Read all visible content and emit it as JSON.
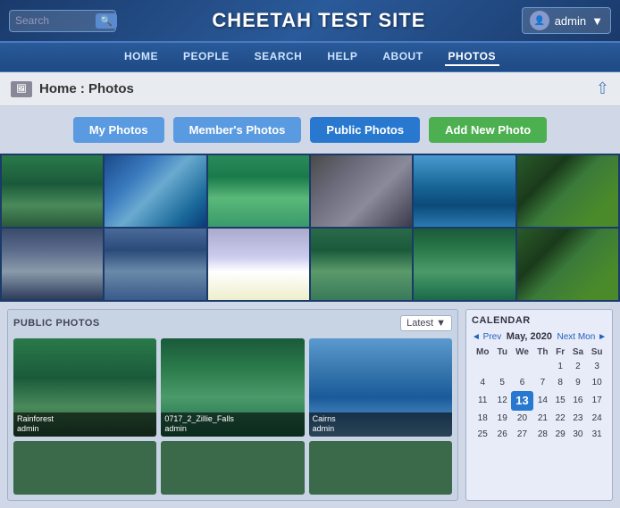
{
  "site": {
    "title": "CHEETAH TEST SITE"
  },
  "header": {
    "search_placeholder": "Search",
    "user_label": "admin",
    "search_icon": "🔍"
  },
  "nav": {
    "items": [
      {
        "label": "HOME",
        "active": false
      },
      {
        "label": "PEOPLE",
        "active": false
      },
      {
        "label": "SEARCH",
        "active": false
      },
      {
        "label": "HELP",
        "active": false
      },
      {
        "label": "ABOUT",
        "active": false
      },
      {
        "label": "PHOTOS",
        "active": true
      }
    ]
  },
  "breadcrumb": {
    "text": "Home : Photos"
  },
  "tabs": [
    {
      "label": "My Photos",
      "active": false
    },
    {
      "label": "Member's Photos",
      "active": false
    },
    {
      "label": "Public Photos",
      "active": true
    },
    {
      "label": "Add New Photo",
      "active": false
    }
  ],
  "public_photos": {
    "section_title": "PUBLIC PHOTOS",
    "sort_label": "Latest",
    "photos": [
      {
        "title": "Rainforest",
        "author": "admin"
      },
      {
        "title": "0717_2_Zillie_Falls",
        "author": "admin"
      },
      {
        "title": "Cairns",
        "author": "admin"
      }
    ]
  },
  "calendar": {
    "title": "CALENDAR",
    "prev_label": "◄ Prev",
    "next_label": "Next Mon ►",
    "month_label": "May, 2020",
    "weekdays": [
      "Mo",
      "Tu",
      "We",
      "Th",
      "Fr",
      "Sa",
      "Su"
    ],
    "weeks": [
      [
        "",
        "",
        "",
        "",
        "1",
        "2",
        "3"
      ],
      [
        "4",
        "5",
        "6",
        "7",
        "8",
        "9",
        "10"
      ],
      [
        "11",
        "12",
        "13",
        "14",
        "15",
        "16",
        "17"
      ],
      [
        "18",
        "19",
        "20",
        "21",
        "22",
        "23",
        "24"
      ],
      [
        "25",
        "26",
        "27",
        "28",
        "29",
        "30",
        "31"
      ]
    ],
    "today": "13"
  }
}
